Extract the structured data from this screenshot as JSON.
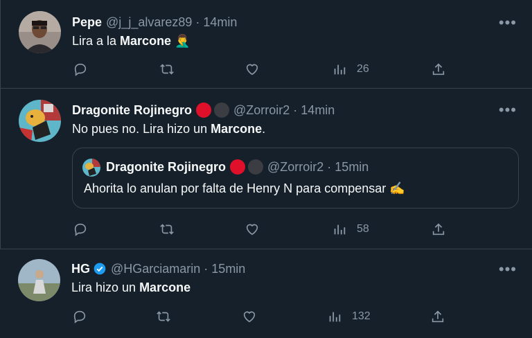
{
  "tweets": [
    {
      "name": "Pepe",
      "handle": "@j_j_alvarez89",
      "time": "· 14min",
      "text_pre": "Lira a la ",
      "text_bold": "Marcone",
      "text_post": " ",
      "emoji": "🤦‍♂️",
      "views": "26"
    },
    {
      "name": "Dragonite Rojinegro",
      "handle": "@Zorroir2",
      "time": "· 14min",
      "text_pre": "No pues no. Lira hizo un ",
      "text_bold": "Marcone",
      "text_post": ".",
      "views": "58",
      "quote": {
        "name": "Dragonite Rojinegro",
        "handle": "@Zorroir2",
        "time": "· 15min",
        "text": "Ahorita lo anulan por falta de Henry N para compensar ",
        "emoji": "✍️"
      }
    },
    {
      "name": "HG",
      "handle": "@HGarciamarin",
      "time": "· 15min",
      "text_pre": "Lira hizo un ",
      "text_bold": "Marcone",
      "text_post": "",
      "views": "132"
    }
  ],
  "icons": {
    "more": "more-icon",
    "reply": "reply-icon",
    "retweet": "retweet-icon",
    "like": "like-icon",
    "views": "views-icon",
    "share": "share-icon",
    "verified": "verified-badge-icon"
  },
  "colors": {
    "background": "#15202b",
    "border": "#38444d",
    "muted": "#8b98a5",
    "verified": "#1d9bf0",
    "red_dot": "#e0102a"
  }
}
